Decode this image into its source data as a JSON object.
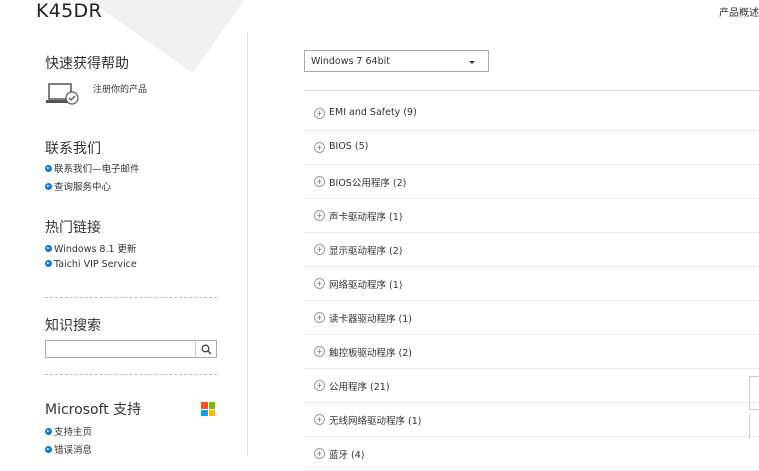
{
  "header": {
    "model": "K45DR",
    "top_link": "产品概述"
  },
  "sidebar": {
    "help_heading": "快速获得帮助",
    "register_label": "注册你的产品",
    "contact_heading": "联系我们",
    "contact_links": [
      "联系我们—电子邮件",
      "查询服务中心"
    ],
    "hot_heading": "热门链接",
    "hot_links": [
      "Windows 8.1 更新",
      "Taichi VIP Service"
    ],
    "knowledge_heading": "知识搜索",
    "search_placeholder": "",
    "ms_heading": "Microsoft 支持",
    "ms_links": [
      "支持主页",
      "错误消息"
    ]
  },
  "main": {
    "os_selected": "Windows 7 64bit",
    "categories": [
      {
        "label": "EMI and Safety",
        "count": "(9)"
      },
      {
        "label": "BIOS",
        "count": "(5)"
      },
      {
        "label": "BIOS公用程序",
        "count": "(2)"
      },
      {
        "label": "声卡驱动程序",
        "count": "(1)"
      },
      {
        "label": "显示驱动程序",
        "count": "(2)"
      },
      {
        "label": "网络驱动程序",
        "count": "(1)"
      },
      {
        "label": "读卡器驱动程序",
        "count": "(1)"
      },
      {
        "label": "触控板驱动程序",
        "count": "(2)"
      },
      {
        "label": "公用程序",
        "count": "(21)"
      },
      {
        "label": "无线网络驱动程序",
        "count": "(1)"
      },
      {
        "label": "蓝牙",
        "count": "(4)"
      }
    ]
  },
  "colors": {
    "accent_blue": "#0a7bd6",
    "ms_red": "#f25022",
    "ms_green": "#7fba00",
    "ms_blue": "#00a4ef",
    "ms_yellow": "#ffb900"
  }
}
